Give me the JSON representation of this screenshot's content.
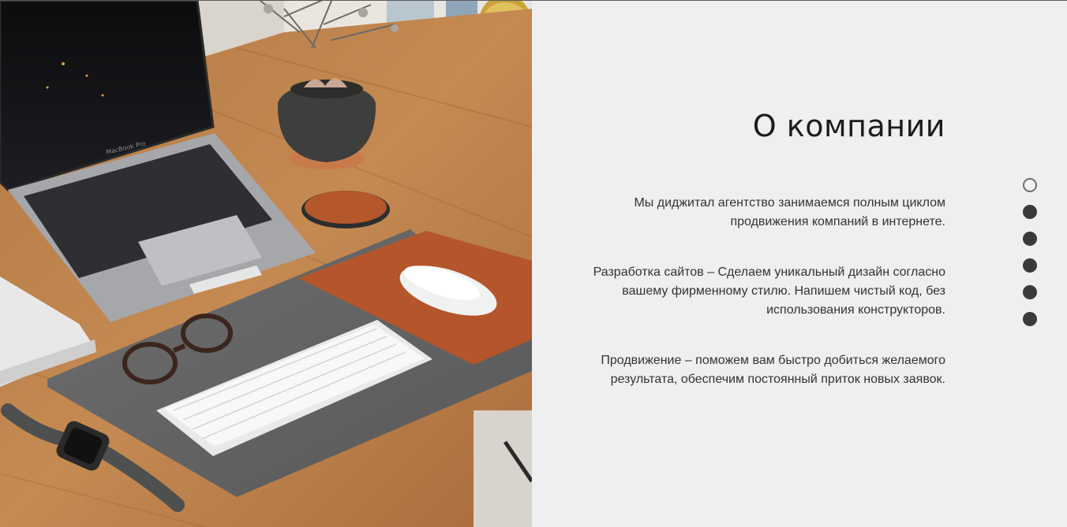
{
  "about": {
    "title": "О компании",
    "paragraphs": [
      "Мы диджитал агентство занимаемся полным циклом продвижения компаний в интернете.",
      "Разработка сайтов – Сделаем уникальный дизайн согласно вашему фирменному стилю. Напишем чистый код, без использования конструкторов.",
      "Продвижение – поможем вам быстро добиться желаемого результата, обеспечим постоянный приток новых заявок."
    ]
  },
  "slider": {
    "dot_count": 6,
    "active_index": 0
  },
  "photo": {
    "laptop_label": "MacBook Pro"
  },
  "colors": {
    "background": "#efefef",
    "title": "#1c1c1c",
    "text": "#333333",
    "dot": "#3a3a3a"
  }
}
